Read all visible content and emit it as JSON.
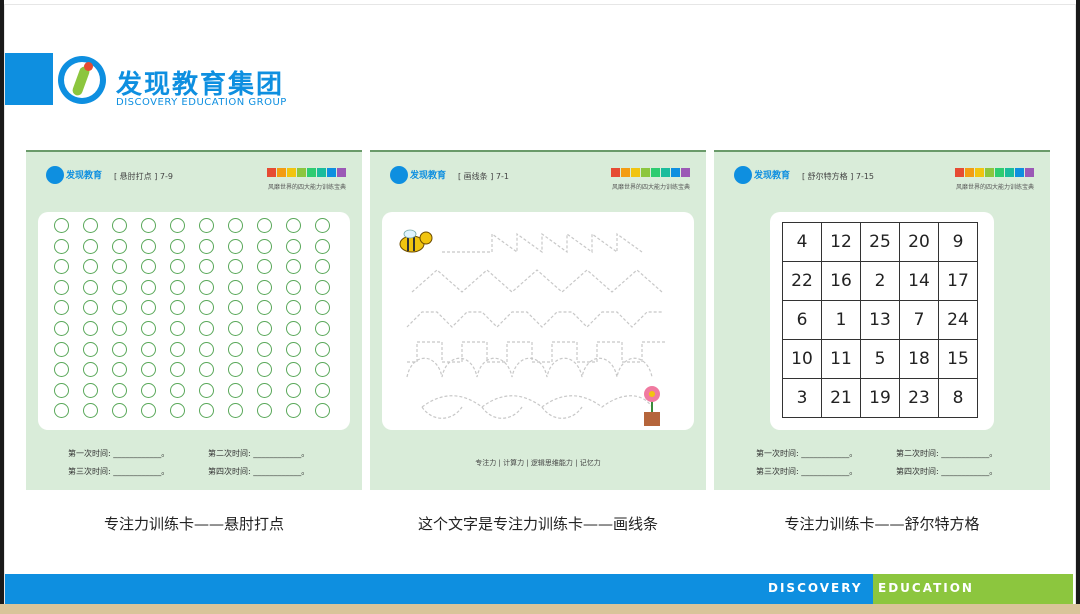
{
  "header": {
    "logo_cn": "发现教育集团",
    "logo_en": "DISCOVERY EDUCATION GROUP"
  },
  "cards": [
    {
      "brand": "发现教育",
      "title": "[ 悬肘打点 ] 7-9",
      "tagline": "风靡世界的四大能力训练宝典",
      "time_labels": [
        "第一次时间: ____________。",
        "第二次时间: ____________。",
        "第三次时间: ____________。",
        "第四次时间: ____________。"
      ],
      "caption": "专注力训练卡——悬肘打点"
    },
    {
      "brand": "发现教育",
      "title": "[ 画线条 ] 7-1",
      "tagline": "风靡世界的四大能力训练宝典",
      "footer_note": "专注力 | 计算力 | 逻辑思维能力 | 记忆力",
      "caption": "这个文字是专注力训练卡——画线条"
    },
    {
      "brand": "发现教育",
      "title": "[ 舒尔特方格 ] 7-15",
      "tagline": "风靡世界的四大能力训练宝典",
      "grid": [
        [
          "4",
          "12",
          "25",
          "20",
          "9"
        ],
        [
          "22",
          "16",
          "2",
          "14",
          "17"
        ],
        [
          "6",
          "1",
          "13",
          "7",
          "24"
        ],
        [
          "10",
          "11",
          "5",
          "18",
          "15"
        ],
        [
          "3",
          "21",
          "19",
          "23",
          "8"
        ]
      ],
      "time_labels": [
        "第一次时间: ____________。",
        "第二次时间: ____________。",
        "第三次时间: ____________。",
        "第四次时间: ____________。"
      ],
      "caption": "专注力训练卡——舒尔特方格"
    }
  ],
  "footer": {
    "left_text": "DISCOVERY",
    "right_text": "EDUCATION"
  },
  "colors": {
    "brand_blue": "#0e8fe0",
    "brand_green": "#8cc63e",
    "card_bg": "#d9ecd9"
  }
}
